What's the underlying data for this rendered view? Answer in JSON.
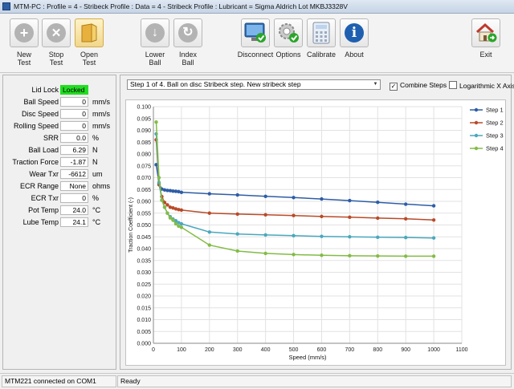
{
  "window": {
    "title": "MTM-PC : Profile = 4 - Stribeck Profile : Data = 4 - Stribeck Profile : Lubricant = Sigma Aldrich Lot MKBJ3328V"
  },
  "toolbar": {
    "new_test": "New\nTest",
    "stop_test": "Stop\nTest",
    "open_test": "Open\nTest",
    "lower_ball": "Lower\nBall",
    "index_ball": "Index\nBall",
    "disconnect": "Disconnect",
    "options": "Options",
    "calibrate": "Calibrate",
    "about": "About",
    "exit": "Exit"
  },
  "fields": [
    {
      "label": "Lid Lock",
      "value": "Locked",
      "unit": ""
    },
    {
      "label": "Ball Speed",
      "value": "0",
      "unit": "mm/s"
    },
    {
      "label": "Disc Speed",
      "value": "0",
      "unit": "mm/s"
    },
    {
      "label": "Rolling Speed",
      "value": "0",
      "unit": "mm/s"
    },
    {
      "label": "SRR",
      "value": "0.0",
      "unit": "%"
    },
    {
      "label": "Ball Load",
      "value": "6.29",
      "unit": "N"
    },
    {
      "label": "Traction Force",
      "value": "-1.87",
      "unit": "N"
    },
    {
      "label": "Wear Txr",
      "value": "-6612",
      "unit": "um"
    },
    {
      "label": "ECR Range",
      "value": "None",
      "unit": "ohms"
    },
    {
      "label": "ECR Txr",
      "value": "0",
      "unit": "%"
    },
    {
      "label": "Pot Temp",
      "value": "24.0",
      "unit": "°C"
    },
    {
      "label": "Lube Temp",
      "value": "24.1",
      "unit": "°C"
    }
  ],
  "controls": {
    "step_select": "Step 1 of 4. Ball on disc Stribeck step. New stribeck step",
    "combine_steps": "Combine Steps",
    "combine_checked": true,
    "log_x": "Logarithmic X Axis",
    "log_checked": false
  },
  "status": {
    "connection": "MTM221 connected on COM1",
    "state": "Ready"
  },
  "chart_data": {
    "type": "line",
    "xlabel": "Speed (mm/s)",
    "ylabel": "Traction Coefficient (-)",
    "xlim": [
      0,
      1100
    ],
    "ylim": [
      0,
      0.1
    ],
    "xticks": [
      0,
      100,
      200,
      300,
      400,
      500,
      600,
      700,
      800,
      900,
      1000,
      1100
    ],
    "yticks": [
      0,
      0.005,
      0.01,
      0.015,
      0.02,
      0.025,
      0.03,
      0.035,
      0.04,
      0.045,
      0.05,
      0.055,
      0.06,
      0.065,
      0.07,
      0.075,
      0.08,
      0.085,
      0.09,
      0.095,
      0.1
    ],
    "x_tick_labels": [
      "0",
      "100",
      "200",
      "300",
      "400",
      "500",
      "600",
      "700",
      "800",
      "900",
      "1000",
      "1100"
    ],
    "y_tick_labels": [
      "0.000",
      "0.005",
      "0.010",
      "0.015",
      "0.020",
      "0.025",
      "0.030",
      "0.035",
      "0.040",
      "0.045",
      "0.050",
      "0.055",
      "0.060",
      "0.065",
      "0.070",
      "0.075",
      "0.080",
      "0.085",
      "0.090",
      "0.095",
      "0.100"
    ],
    "grid": true,
    "legend": "right",
    "x": [
      10,
      20,
      30,
      40,
      50,
      60,
      70,
      80,
      90,
      100,
      200,
      300,
      400,
      500,
      600,
      700,
      800,
      900,
      1000
    ],
    "series": [
      {
        "name": "Step 1",
        "color": "#2e5da6",
        "values": [
          0.0755,
          0.0675,
          0.0652,
          0.0648,
          0.0646,
          0.0645,
          0.0643,
          0.0642,
          0.0641,
          0.0638,
          0.0632,
          0.0627,
          0.0621,
          0.0616,
          0.061,
          0.0603,
          0.0596,
          0.0588,
          0.0581
        ]
      },
      {
        "name": "Step 2",
        "color": "#b94a28",
        "values": [
          0.086,
          0.067,
          0.062,
          0.0595,
          0.0585,
          0.0575,
          0.0572,
          0.0568,
          0.0565,
          0.0563,
          0.055,
          0.0546,
          0.0543,
          0.054,
          0.0536,
          0.0533,
          0.0529,
          0.0526,
          0.0521
        ]
      },
      {
        "name": "Step 3",
        "color": "#4aa8bd",
        "values": [
          0.0885,
          0.068,
          0.0605,
          0.0575,
          0.055,
          0.0535,
          0.0525,
          0.0518,
          0.051,
          0.0505,
          0.047,
          0.0462,
          0.0458,
          0.0455,
          0.0452,
          0.045,
          0.0448,
          0.0447,
          0.0445
        ]
      },
      {
        "name": "Step 4",
        "color": "#82bc45",
        "values": [
          0.0935,
          0.07,
          0.0605,
          0.0575,
          0.055,
          0.053,
          0.052,
          0.0505,
          0.0495,
          0.049,
          0.0415,
          0.039,
          0.038,
          0.0375,
          0.0372,
          0.037,
          0.0369,
          0.0368,
          0.0368
        ]
      }
    ]
  }
}
